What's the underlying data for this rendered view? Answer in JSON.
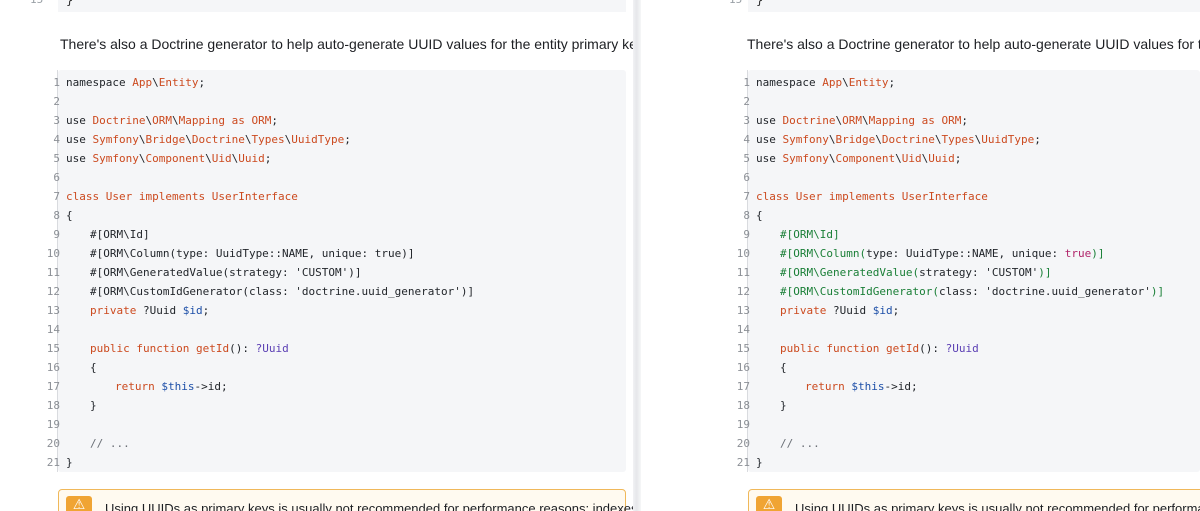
{
  "prev_line": {
    "number": "15",
    "text": "}"
  },
  "intro_text": "There's also a Doctrine generator to help auto-generate UUID values for the entity primary keys:",
  "intro_text_right": "There's also a Doctrine generator to help auto-generate UUID values for the entity p",
  "line_numbers": [
    "1",
    "2",
    "3",
    "4",
    "5",
    "6",
    "7",
    "8",
    "9",
    "10",
    "11",
    "12",
    "13",
    "14",
    "15",
    "16",
    "17",
    "18",
    "19",
    "20",
    "21"
  ],
  "code": {
    "l1": {
      "a": "namespace ",
      "b": "App",
      "c": "\\",
      "d": "Entity",
      "e": ";"
    },
    "l3": {
      "a": "use ",
      "b": "Doctrine",
      "c": "\\",
      "d": "ORM",
      "e": "\\",
      "f": "Mapping",
      "g": " as ",
      "h": "ORM",
      "i": ";"
    },
    "l4": {
      "a": "use ",
      "b": "Symfony",
      "c": "\\",
      "d": "Bridge",
      "e": "\\",
      "f": "Doctrine",
      "g": "\\",
      "h": "Types",
      "i": "\\",
      "j": "UuidType",
      "k": ";"
    },
    "l5": {
      "a": "use ",
      "b": "Symfony",
      "c": "\\",
      "d": "Component",
      "e": "\\",
      "f": "Uid",
      "g": "\\",
      "h": "Uuid",
      "i": ";"
    },
    "l7": {
      "a": "class ",
      "b": "User",
      "c": " implements ",
      "d": "UserInterface"
    },
    "l8": "{",
    "l9": {
      "a": "#[ORM\\Id]"
    },
    "l10": {
      "a": "#[ORM\\Column(",
      "b": "type: UuidType::NAME, unique: ",
      "c": "true",
      "d": ")]"
    },
    "l11": {
      "a": "#[ORM\\GeneratedValue(",
      "b": "strategy: 'CUSTOM'",
      "c": ")]"
    },
    "l12": {
      "a": "#[ORM\\CustomIdGenerator(",
      "b": "class: 'doctrine.uuid_generator'",
      "c": ")]"
    },
    "l13": {
      "a": "private ",
      "b": "?Uuid ",
      "c": "$id",
      "d": ";"
    },
    "l15": {
      "a": "public function ",
      "b": "getId",
      "c": "(): ",
      "d": "?Uuid"
    },
    "l16": "{",
    "l17": {
      "a": "return ",
      "b": "$this",
      "c": "->id;"
    },
    "l18": "}",
    "l20": "// ...",
    "l21": "}"
  },
  "alert": {
    "icon": "warning-icon",
    "text_left": "Using UUIDs as primary keys is usually not recommended for performance reasons: indexes",
    "text_right": "Using UUIDs as primary keys is usually not recommended for performance"
  },
  "colors": {
    "accent": "#cc4a1f",
    "attribute_green": "#1a7f37",
    "warning": "#f0a433",
    "code_bg": "#f5f6f8"
  }
}
